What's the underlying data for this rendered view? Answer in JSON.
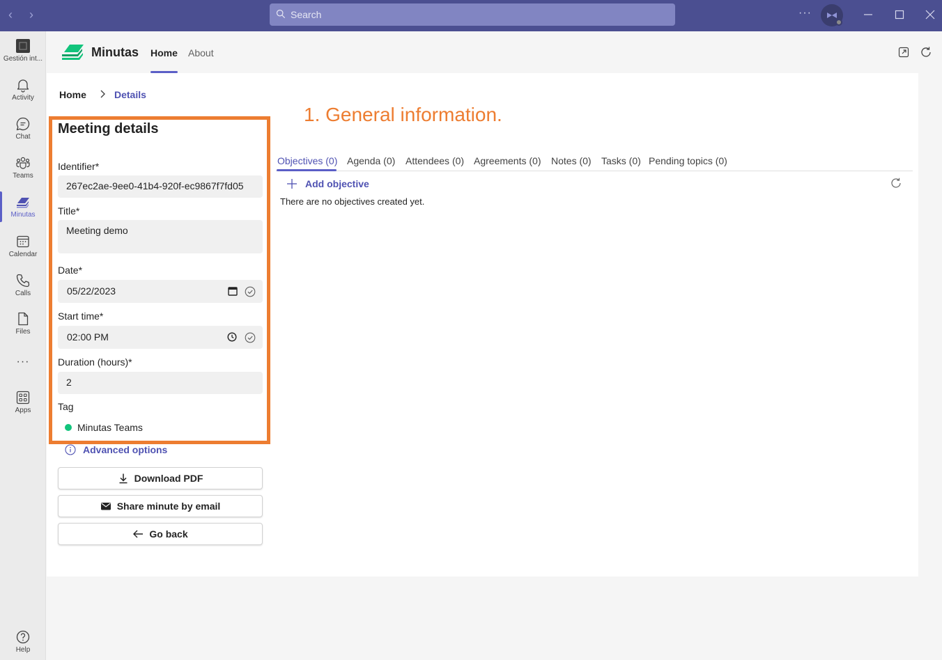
{
  "titlebar": {
    "search_placeholder": "Search",
    "more": "···"
  },
  "rail": {
    "items": [
      {
        "label": "Gestión int...",
        "icon": "org-tile-icon"
      },
      {
        "label": "Activity",
        "icon": "bell-icon"
      },
      {
        "label": "Chat",
        "icon": "chat-icon"
      },
      {
        "label": "Teams",
        "icon": "teams-icon"
      },
      {
        "label": "Minutas",
        "icon": "minutas-icon"
      },
      {
        "label": "Calendar",
        "icon": "calendar-icon"
      },
      {
        "label": "Calls",
        "icon": "phone-icon"
      },
      {
        "label": "Files",
        "icon": "file-icon"
      },
      {
        "label": "···",
        "icon": "more-icon"
      },
      {
        "label": "Apps",
        "icon": "apps-icon"
      },
      {
        "label": "Help",
        "icon": "help-icon"
      }
    ],
    "active": "Minutas"
  },
  "app": {
    "name": "Minutas",
    "tabs": [
      "Home",
      "About"
    ],
    "active_tab": "Home"
  },
  "breadcrumb": {
    "home": "Home",
    "current": "Details"
  },
  "annotation": "1. General information.",
  "form": {
    "title": "Meeting details",
    "identifier_label": "Identifier*",
    "identifier_value": "267ec2ae-9ee0-41b4-920f-ec9867f7fd05",
    "title_label": "Title*",
    "title_value": "Meeting  demo",
    "date_label": "Date*",
    "date_value": "05/22/2023",
    "start_label": "Start time*",
    "start_value": "02:00  PM",
    "duration_label": "Duration (hours)*",
    "duration_value": "2",
    "tag_label": "Tag",
    "tag_value": "Minutas Teams",
    "tag_color": "#12c47c"
  },
  "advanced_options": "Advanced options",
  "buttons": {
    "download": "Download PDF",
    "share": "Share minute by email",
    "back": "Go back"
  },
  "tabs": [
    "Objectives (0)",
    "Agenda (0)",
    "Attendees (0)",
    "Agreements (0)",
    "Notes (0)",
    "Tasks (0)",
    "Pending topics (0)"
  ],
  "objectives": {
    "add_label": "Add objective",
    "empty_message": "There are no objectives created yet."
  },
  "colors": {
    "titlebar": "#4b4f91",
    "accent": "#5b5fc7",
    "annotation": "#ed7d31"
  }
}
